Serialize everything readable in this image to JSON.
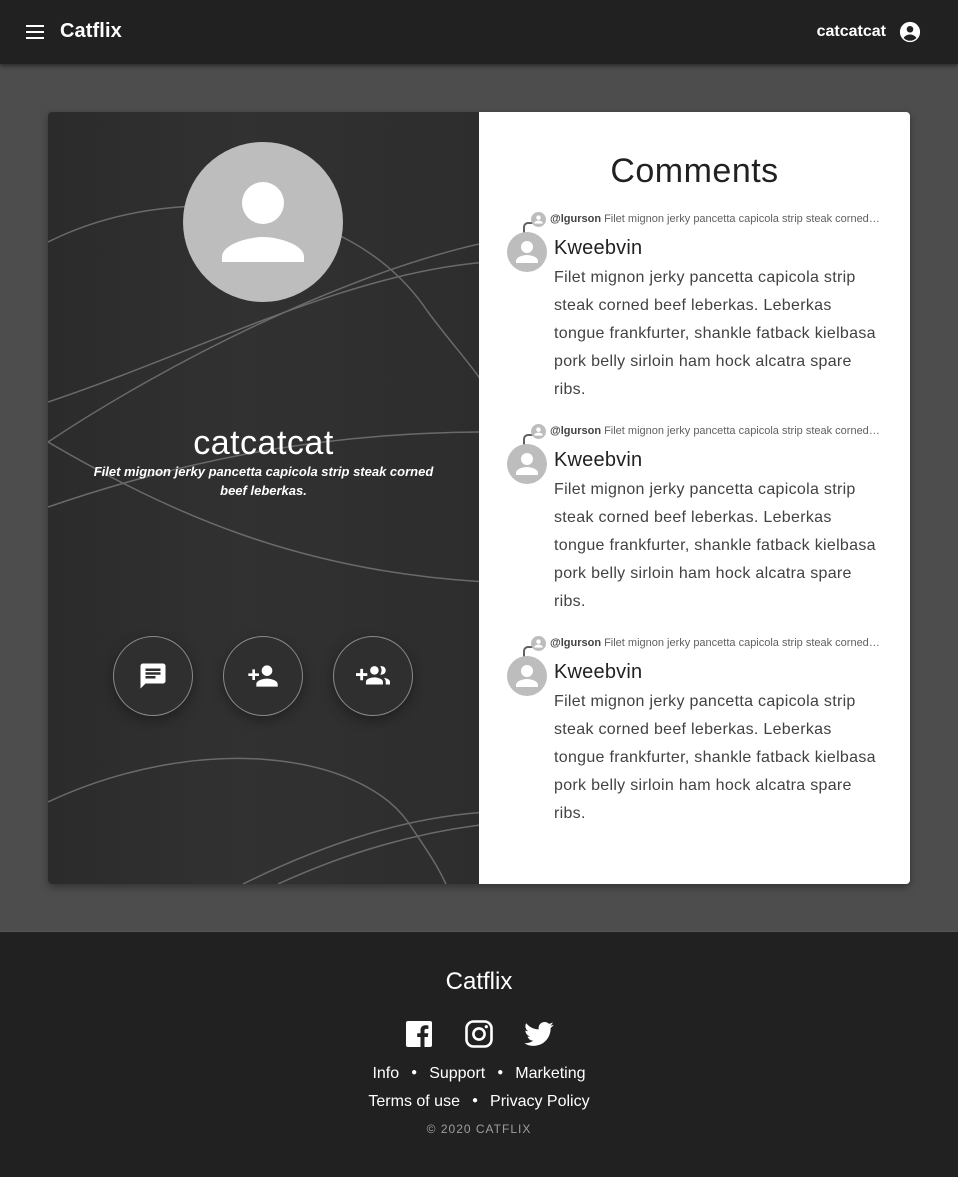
{
  "appbar": {
    "brand": "Catflix",
    "username": "catcatcat"
  },
  "profile": {
    "name": "catcatcat",
    "bio": "Filet mignon jerky pancetta capicola strip steak corned beef leberkas."
  },
  "comments": {
    "title": "Comments",
    "items": [
      {
        "reply_user": "@lgurson",
        "reply_text": "Filet mignon jerky pancetta capicola strip steak corned beef leberkas.",
        "author": "Kweebvin",
        "body": "Filet mignon jerky pancetta capicola strip steak corned beef leberkas. Leberkas tongue frankfurter, shankle fatback kielbasa pork belly sirloin ham hock alcatra spare ribs."
      },
      {
        "reply_user": "@lgurson",
        "reply_text": "Filet mignon jerky pancetta capicola strip steak corned beef leberkas.",
        "author": "Kweebvin",
        "body": "Filet mignon jerky pancetta capicola strip steak corned beef leberkas. Leberkas tongue frankfurter, shankle fatback kielbasa pork belly sirloin ham hock alcatra spare ribs."
      },
      {
        "reply_user": "@lgurson",
        "reply_text": "Filet mignon jerky pancetta capicola strip steak corned beef leberkas.",
        "author": "Kweebvin",
        "body": "Filet mignon jerky pancetta capicola strip steak corned beef leberkas. Leberkas tongue frankfurter, shankle fatback kielbasa pork belly sirloin ham hock alcatra spare ribs."
      }
    ]
  },
  "actions": {
    "icons": [
      "message-icon",
      "add-person-icon",
      "add-group-icon"
    ]
  },
  "footer": {
    "brand": "Catflix",
    "social_icons": [
      "facebook-icon",
      "instagram-icon",
      "twitter-icon"
    ],
    "links_row1": [
      "Info",
      "Support",
      "Marketing"
    ],
    "links_row2": [
      "Terms of use",
      "Privacy Policy"
    ],
    "copyright": "© 2020 CATFLIX"
  },
  "colors": {
    "appbar_bg": "#212121",
    "page_bg": "#4d4d4d",
    "panel_dark": "#2f2f2f",
    "avatar_grey": "#bdbdbd"
  }
}
